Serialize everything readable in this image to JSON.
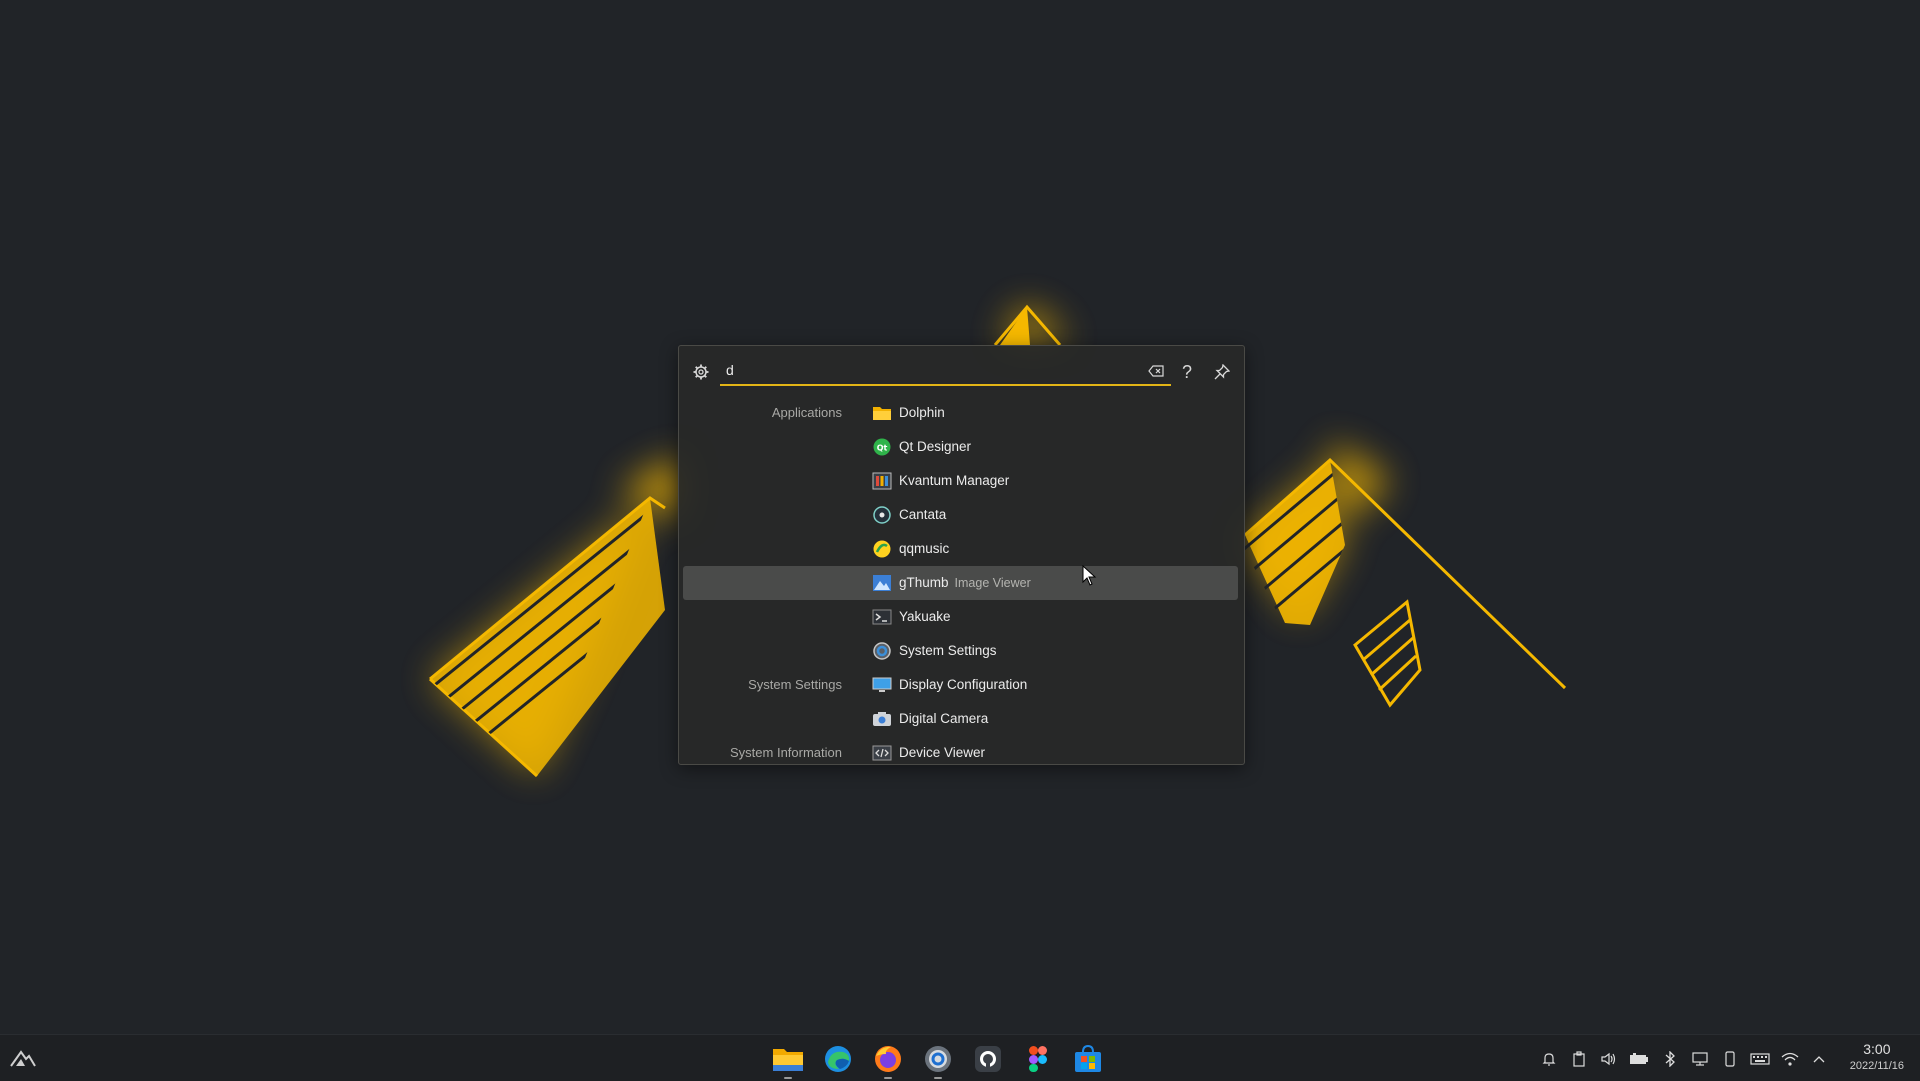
{
  "search": {
    "value": "d",
    "placeholder": ""
  },
  "toolbar": {
    "help_label": "?"
  },
  "results": [
    {
      "category": "Applications",
      "title": "Dolphin",
      "subtitle": "",
      "icon": "folder-icon"
    },
    {
      "category": "",
      "title": "Qt Designer",
      "subtitle": "",
      "icon": "qt-designer-icon"
    },
    {
      "category": "",
      "title": "Kvantum Manager",
      "subtitle": "",
      "icon": "kvantum-icon"
    },
    {
      "category": "",
      "title": "Cantata",
      "subtitle": "",
      "icon": "cantata-icon"
    },
    {
      "category": "",
      "title": "qqmusic",
      "subtitle": "",
      "icon": "qqmusic-icon"
    },
    {
      "category": "",
      "title": "gThumb",
      "subtitle": "Image Viewer",
      "icon": "image-viewer-icon"
    },
    {
      "category": "",
      "title": "Yakuake",
      "subtitle": "",
      "icon": "terminal-icon"
    },
    {
      "category": "",
      "title": "System Settings",
      "subtitle": "",
      "icon": "settings-icon"
    },
    {
      "category": "System Settings",
      "title": "Display Configuration",
      "subtitle": "",
      "icon": "display-icon"
    },
    {
      "category": "",
      "title": "Digital Camera",
      "subtitle": "",
      "icon": "camera-icon"
    },
    {
      "category": "System Information",
      "title": "Device Viewer",
      "subtitle": "",
      "icon": "device-viewer-icon"
    }
  ],
  "taskbar": {
    "apps": [
      "file-manager-icon",
      "edge-icon",
      "firefox-icon",
      "system-settings-icon",
      "github-icon",
      "figma-icon",
      "store-icon"
    ],
    "tray": [
      "notification-icon",
      "clipboard-icon",
      "volume-icon",
      "battery-icon",
      "bluetooth-icon",
      "network-icon",
      "phone-icon",
      "keyboard-icon",
      "wifi-icon",
      "expand-tray-icon"
    ]
  },
  "clock": {
    "time": "3:00",
    "date": "2022/11/16"
  },
  "colors": {
    "accent": "#e2b416",
    "background": "#212428",
    "glow": "#f5b800"
  }
}
